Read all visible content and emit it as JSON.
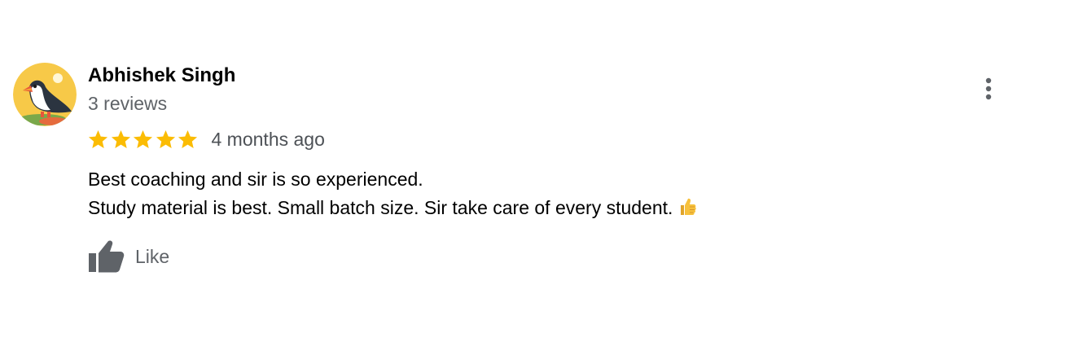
{
  "review": {
    "reviewer_name": "Abhishek Singh",
    "review_count": "3 reviews",
    "rating": 5,
    "rating_max": 5,
    "date": "4 months ago",
    "text_lines": [
      "Best coaching and sir is so experienced.",
      "Study material is best. Small batch size. Sir take care of every student."
    ],
    "inline_emoji": "thumbs-up-emoji",
    "like_label": "Like",
    "more_options_icon": "more-vert-icon",
    "avatar_icon": "puffin-avatar-icon"
  },
  "colors": {
    "star": "#fbbc04",
    "secondary_text": "#5f6368",
    "icon": "#5f6368"
  }
}
